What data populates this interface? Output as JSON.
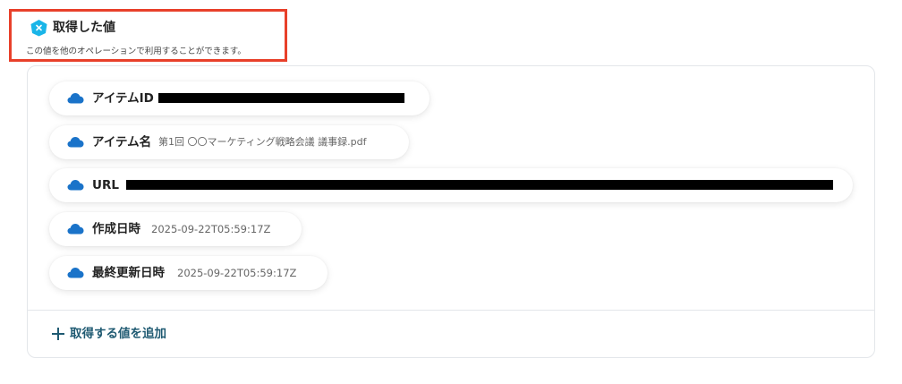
{
  "section": {
    "title": "取得した値",
    "description": "この値を他のオペレーションで利用することができます。"
  },
  "fields": [
    {
      "label": "アイテムID",
      "value": ""
    },
    {
      "label": "アイテム名",
      "value": "第1回 〇〇マーケティング戦略会議 議事録.pdf"
    },
    {
      "label": "URL",
      "value": ""
    },
    {
      "label": "作成日時",
      "value": "2025-09-22T05:59:17Z"
    },
    {
      "label": "最終更新日時",
      "value": "2025-09-22T05:59:17Z"
    }
  ],
  "add_button": {
    "label": "取得する値を追加"
  },
  "colors": {
    "accent": "#1f5a72",
    "highlight_border": "#e8402a",
    "cloud": "#1a73c9",
    "header_icon": "#19b5e8"
  },
  "icons": {
    "header": "yoom-hexagon-icon",
    "field": "onedrive-cloud-icon",
    "add": "plus-icon"
  }
}
